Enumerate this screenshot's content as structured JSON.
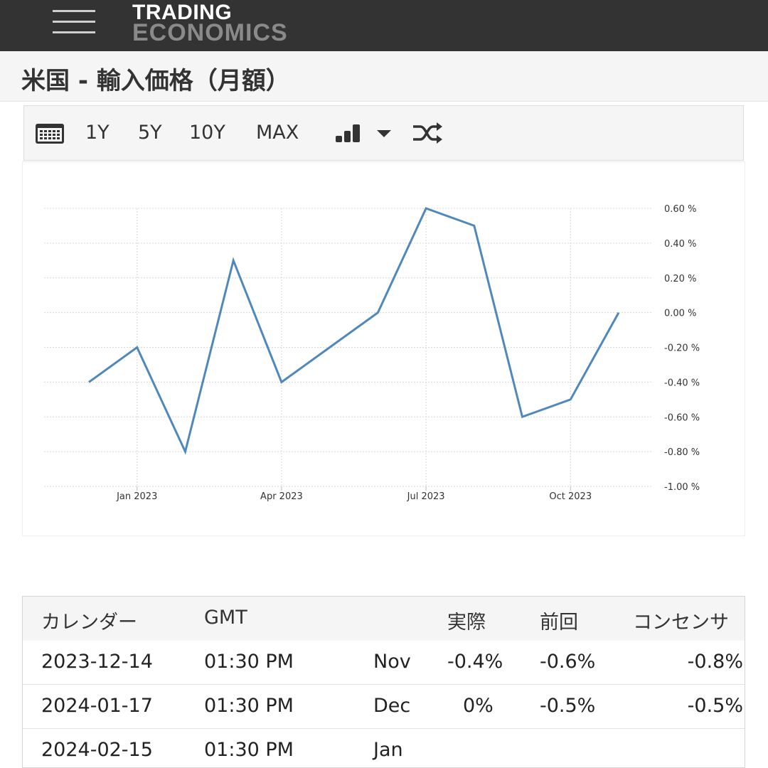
{
  "header": {
    "logo_line1": "TRADING",
    "logo_line2": "ECONOMICS",
    "page_title": "米国 - 輸入価格（月額）"
  },
  "toolbar": {
    "ranges": [
      "1Y",
      "5Y",
      "10Y",
      "MAX"
    ],
    "icons": [
      "calendar-icon",
      "bar-chart-icon",
      "dropdown-caret-icon",
      "shuffle-icon"
    ]
  },
  "chart_data": {
    "type": "line",
    "x": [
      "2022-12",
      "2023-01",
      "2023-02",
      "2023-03",
      "2023-04",
      "2023-05",
      "2023-06",
      "2023-07",
      "2023-08",
      "2023-09",
      "2023-10",
      "2023-11"
    ],
    "values": [
      -0.4,
      -0.2,
      -0.8,
      0.3,
      -0.4,
      -0.2,
      0.0,
      0.6,
      0.5,
      -0.6,
      -0.5,
      0.0
    ],
    "x_tick_labels": [
      "Jan 2023",
      "Apr 2023",
      "Jul 2023",
      "Oct 2023"
    ],
    "y_tick_labels": [
      "0.60 %",
      "0.40 %",
      "0.20 %",
      "0.00 %",
      "-0.20 %",
      "-0.40 %",
      "-0.60 %",
      "-0.80 %",
      "-1.00 %"
    ],
    "ylim": [
      -1.0,
      0.6
    ],
    "y_axis_position": "right",
    "grid": true,
    "line_color": "#4f88bc"
  },
  "calendar": {
    "headers": [
      "カレンダー",
      "GMT",
      "",
      "実際",
      "前回",
      "コンセンサ"
    ],
    "rows": [
      [
        "2023-12-14",
        "01:30 PM",
        "Nov",
        "-0.4%",
        "-0.6%",
        "-0.8%"
      ],
      [
        "2024-01-17",
        "01:30 PM",
        "Dec",
        "0%",
        "-0.5%",
        "-0.5%"
      ],
      [
        "2024-02-15",
        "01:30 PM",
        "Jan",
        "",
        "",
        ""
      ]
    ]
  }
}
